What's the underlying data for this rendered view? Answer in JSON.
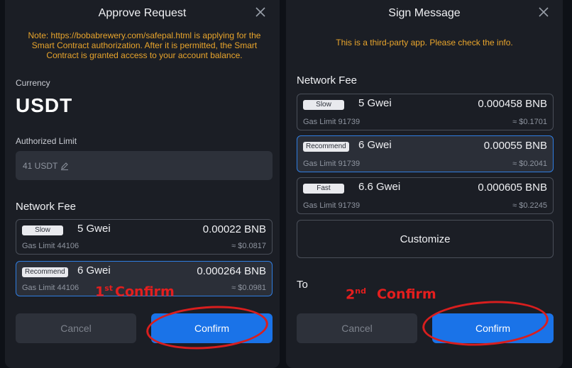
{
  "left": {
    "title": "Approve Request",
    "note": "Note: https://bobabrewery.com/safepal.html is applying for the Smart Contract authorization. After it is permitted, the Smart Contract is granted access to your account balance.",
    "currency_label": "Currency",
    "currency_value": "USDT",
    "limit_label": "Authorized Limit",
    "limit_value": "41 USDT",
    "network_fee_label": "Network Fee",
    "fees": [
      {
        "speed": "Slow",
        "gwei": "5 Gwei",
        "gas_limit": "Gas Limit 44106",
        "bnb": "0.00022 BNB",
        "usd": "≈ $0.0817"
      },
      {
        "speed": "Recommend",
        "gwei": "6 Gwei",
        "gas_limit": "Gas Limit 44106",
        "bnb": "0.000264 BNB",
        "usd": "≈ $0.0981"
      }
    ],
    "cancel_label": "Cancel",
    "confirm_label": "Confirm",
    "annotation_num": "1",
    "annotation_sup": "st",
    "annotation_text": "Confirm"
  },
  "right": {
    "title": "Sign Message",
    "note": "This is a third-party app. Please check the info.",
    "network_fee_label": "Network Fee",
    "fees": [
      {
        "speed": "Slow",
        "gwei": "5 Gwei",
        "gas_limit": "Gas Limit 91739",
        "bnb": "0.000458 BNB",
        "usd": "≈ $0.1701"
      },
      {
        "speed": "Recommend",
        "gwei": "6 Gwei",
        "gas_limit": "Gas Limit 91739",
        "bnb": "0.00055 BNB",
        "usd": "≈ $0.2041"
      },
      {
        "speed": "Fast",
        "gwei": "6.6 Gwei",
        "gas_limit": "Gas Limit 91739",
        "bnb": "0.000605 BNB",
        "usd": "≈ $0.2245"
      }
    ],
    "customize_label": "Customize",
    "to_label": "To",
    "cancel_label": "Cancel",
    "confirm_label": "Confirm",
    "annotation_num": "2",
    "annotation_sup": "nd",
    "annotation_text": "Confirm"
  },
  "colors": {
    "accent": "#1a73e8",
    "warning": "#e9a52c",
    "annotation": "#e41e1e",
    "panel": "#1b1e25"
  },
  "icons": [
    "close-icon",
    "edit-icon"
  ]
}
